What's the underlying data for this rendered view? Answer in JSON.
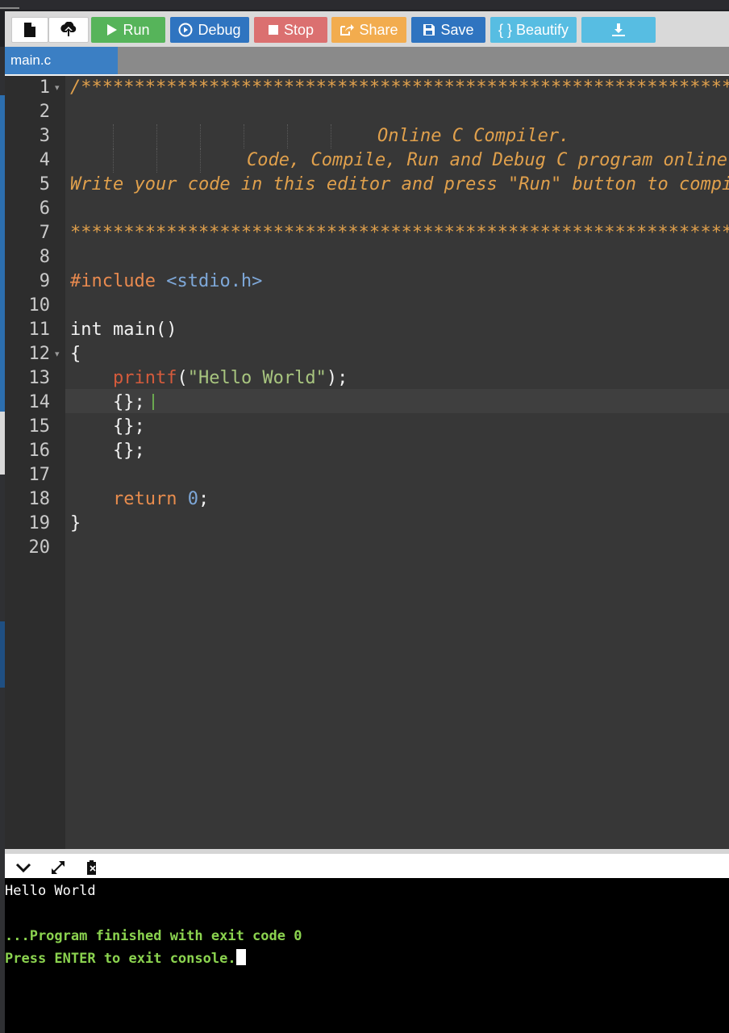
{
  "toolbar": {
    "buttons": [
      {
        "id": "new-file",
        "label": "",
        "icon": "file-icon"
      },
      {
        "id": "upload",
        "label": "",
        "icon": "upload-icon"
      },
      {
        "id": "run",
        "label": "Run",
        "icon": "play-icon"
      },
      {
        "id": "debug",
        "label": "Debug",
        "icon": "debug-icon"
      },
      {
        "id": "stop",
        "label": "Stop",
        "icon": "stop-icon"
      },
      {
        "id": "share",
        "label": "Share",
        "icon": "share-icon"
      },
      {
        "id": "save",
        "label": "Save",
        "icon": "save-icon"
      },
      {
        "id": "beautify",
        "label": "{ } Beautify",
        "icon": ""
      },
      {
        "id": "download",
        "label": "",
        "icon": "download-icon"
      }
    ]
  },
  "tabs": [
    {
      "label": "main.c",
      "active": true
    }
  ],
  "editor": {
    "line_numbers": [
      "1",
      "2",
      "3",
      "4",
      "5",
      "6",
      "7",
      "8",
      "9",
      "10",
      "11",
      "12",
      "13",
      "14",
      "15",
      "16",
      "17",
      "18",
      "19",
      "20"
    ],
    "active_line": 14,
    "lines": {
      "l1": "/*******************************************************************************",
      "l3": "Online C Compiler.",
      "l4": "Code, Compile, Run and Debug C program online.",
      "l5": "Write your code in this editor and press \"Run\" button to compile and execute it.",
      "l7": "*******************************************************************************/",
      "l9_directive": "#include",
      "l9_header": "<stdio.h>",
      "l11": "int main()",
      "l12": "{",
      "l13_indent": "    ",
      "l13_fn": "printf",
      "l13_paren_open": "(",
      "l13_str": "\"Hello World\"",
      "l13_end": ");",
      "l14": "    {};",
      "l15": "    {};",
      "l16": "    {};",
      "l18_indent": "    ",
      "l18_kw": "return",
      "l18_num": "0",
      "l18_end": ";",
      "l19": "}"
    }
  },
  "console": {
    "icons": [
      "chevron-down-icon",
      "expand-icon",
      "clear-console-icon"
    ],
    "lines": [
      "Hello World",
      "",
      "...Program finished with exit code 0",
      "Press ENTER to exit console."
    ]
  },
  "colors": {
    "run": "#56b45a",
    "debug": "#2f74c0",
    "stop": "#db7070",
    "share": "#f2ac4e",
    "save": "#2f74c0",
    "beautify": "#57bde2",
    "download": "#57bde2",
    "editor_bg": "#373737",
    "comment": "#e0a04c",
    "console_green": "#8bd34f"
  }
}
